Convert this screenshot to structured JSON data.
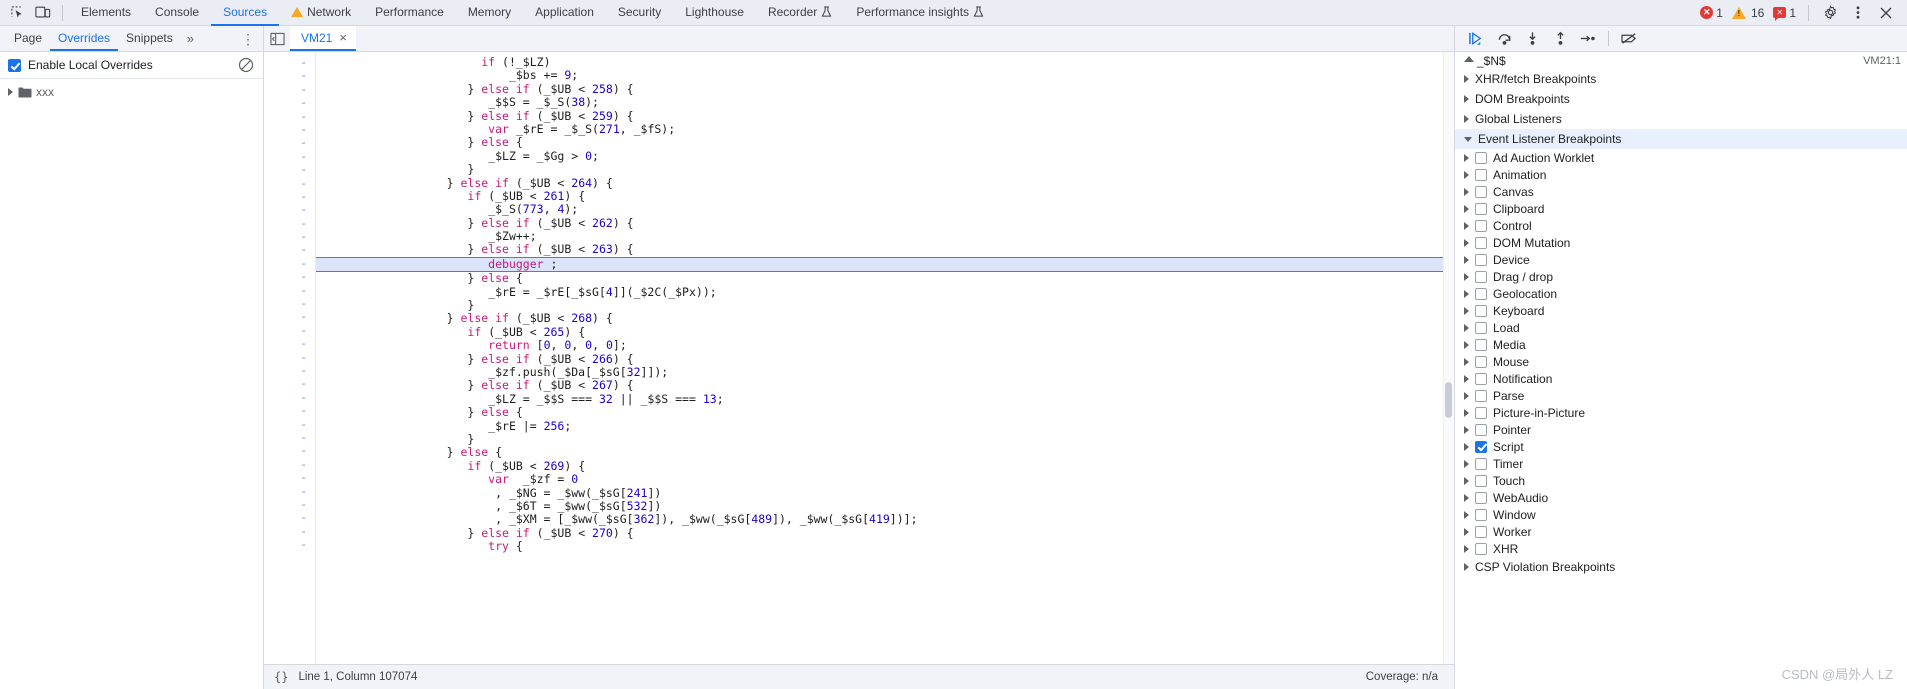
{
  "toolbar": {
    "inspect_icon": "inspect-element-icon",
    "device_icon": "device-toolbar-icon",
    "tabs": [
      {
        "label": "Elements",
        "active": false,
        "warn": false
      },
      {
        "label": "Console",
        "active": false,
        "warn": false
      },
      {
        "label": "Sources",
        "active": true,
        "warn": false
      },
      {
        "label": "Network",
        "active": false,
        "warn": true
      },
      {
        "label": "Performance",
        "active": false,
        "warn": false
      },
      {
        "label": "Memory",
        "active": false,
        "warn": false
      },
      {
        "label": "Application",
        "active": false,
        "warn": false
      },
      {
        "label": "Security",
        "active": false,
        "warn": false
      },
      {
        "label": "Lighthouse",
        "active": false,
        "warn": false
      },
      {
        "label": "Recorder",
        "active": false,
        "warn": false,
        "flask": true
      },
      {
        "label": "Performance insights",
        "active": false,
        "warn": false,
        "flask": true
      }
    ],
    "errors_count": "1",
    "warnings_count": "16",
    "messages_count": "1",
    "settings_icon": "gear-icon",
    "more_icon": "kebab-menu-icon",
    "close_icon": "close-icon"
  },
  "navigator": {
    "tabs": [
      {
        "label": "Page",
        "active": false
      },
      {
        "label": "Overrides",
        "active": true
      },
      {
        "label": "Snippets",
        "active": false
      }
    ],
    "more_label": "»",
    "kebab_label": "⋮",
    "overrides_checkbox_label": "Enable Local Overrides",
    "overrides_checked": true,
    "clear_icon": "clear-overrides-icon",
    "tree": [
      {
        "label": "xxx",
        "expanded": false,
        "icon": "folder-icon"
      }
    ]
  },
  "editor": {
    "panel_toggle_icon": "show-navigator-icon",
    "tab_name": "VM21",
    "tab_close": "×",
    "gutter_marker": "-",
    "line_count": 37,
    "status": {
      "format_icon": "{}",
      "position": "Line 1, Column 107074",
      "coverage": "Coverage: n/a"
    },
    "code_lines": [
      {
        "indent": 23,
        "tokens": [
          {
            "t": "if",
            "c": "kw"
          },
          {
            "t": " (!_$LZ)",
            "c": "var"
          }
        ]
      },
      {
        "indent": 27,
        "tokens": [
          {
            "t": "_$bs += ",
            "c": "var"
          },
          {
            "t": "9",
            "c": "num"
          },
          {
            "t": ";",
            "c": "var"
          }
        ]
      },
      {
        "indent": 21,
        "tokens": [
          {
            "t": "} ",
            "c": "var"
          },
          {
            "t": "else if",
            "c": "kw"
          },
          {
            "t": " (_$UB < ",
            "c": "var"
          },
          {
            "t": "258",
            "c": "num"
          },
          {
            "t": ") {",
            "c": "var"
          }
        ]
      },
      {
        "indent": 24,
        "tokens": [
          {
            "t": "_$$S = _$_S(",
            "c": "var"
          },
          {
            "t": "38",
            "c": "num"
          },
          {
            "t": ");",
            "c": "var"
          }
        ]
      },
      {
        "indent": 21,
        "tokens": [
          {
            "t": "} ",
            "c": "var"
          },
          {
            "t": "else if",
            "c": "kw"
          },
          {
            "t": " (_$UB < ",
            "c": "var"
          },
          {
            "t": "259",
            "c": "num"
          },
          {
            "t": ") {",
            "c": "var"
          }
        ]
      },
      {
        "indent": 24,
        "tokens": [
          {
            "t": "var",
            "c": "kw"
          },
          {
            "t": " _$rE = _$_S(",
            "c": "var"
          },
          {
            "t": "271",
            "c": "num"
          },
          {
            "t": ", _$fS);",
            "c": "var"
          }
        ]
      },
      {
        "indent": 21,
        "tokens": [
          {
            "t": "} ",
            "c": "var"
          },
          {
            "t": "else",
            "c": "kw"
          },
          {
            "t": " {",
            "c": "var"
          }
        ]
      },
      {
        "indent": 24,
        "tokens": [
          {
            "t": "_$LZ = _$Gg > ",
            "c": "var"
          },
          {
            "t": "0",
            "c": "num"
          },
          {
            "t": ";",
            "c": "var"
          }
        ]
      },
      {
        "indent": 21,
        "tokens": [
          {
            "t": "}",
            "c": "var"
          }
        ]
      },
      {
        "indent": 18,
        "tokens": [
          {
            "t": "} ",
            "c": "var"
          },
          {
            "t": "else if",
            "c": "kw"
          },
          {
            "t": " (_$UB < ",
            "c": "var"
          },
          {
            "t": "264",
            "c": "num"
          },
          {
            "t": ") {",
            "c": "var"
          }
        ]
      },
      {
        "indent": 21,
        "tokens": [
          {
            "t": "if",
            "c": "kw"
          },
          {
            "t": " (_$UB < ",
            "c": "var"
          },
          {
            "t": "261",
            "c": "num"
          },
          {
            "t": ") {",
            "c": "var"
          }
        ]
      },
      {
        "indent": 24,
        "tokens": [
          {
            "t": "_$_S(",
            "c": "var"
          },
          {
            "t": "773",
            "c": "num"
          },
          {
            "t": ", ",
            "c": "var"
          },
          {
            "t": "4",
            "c": "num"
          },
          {
            "t": ");",
            "c": "var"
          }
        ]
      },
      {
        "indent": 21,
        "tokens": [
          {
            "t": "} ",
            "c": "var"
          },
          {
            "t": "else if",
            "c": "kw"
          },
          {
            "t": " (_$UB < ",
            "c": "var"
          },
          {
            "t": "262",
            "c": "num"
          },
          {
            "t": ") {",
            "c": "var"
          }
        ]
      },
      {
        "indent": 24,
        "tokens": [
          {
            "t": "_$Zw++;",
            "c": "var"
          }
        ]
      },
      {
        "indent": 21,
        "tokens": [
          {
            "t": "} ",
            "c": "var"
          },
          {
            "t": "else if",
            "c": "kw"
          },
          {
            "t": " (_$UB < ",
            "c": "var"
          },
          {
            "t": "263",
            "c": "num"
          },
          {
            "t": ") {",
            "c": "var"
          }
        ]
      },
      {
        "indent": 24,
        "exec": true,
        "tokens": [
          {
            "t": "debugger",
            "c": "dbg"
          },
          {
            "t": " ;",
            "c": "var"
          }
        ]
      },
      {
        "indent": 21,
        "tokens": [
          {
            "t": "} ",
            "c": "var"
          },
          {
            "t": "else",
            "c": "kw"
          },
          {
            "t": " {",
            "c": "var"
          }
        ]
      },
      {
        "indent": 24,
        "tokens": [
          {
            "t": "_$rE = _$rE[_$sG[",
            "c": "var"
          },
          {
            "t": "4",
            "c": "num"
          },
          {
            "t": "]](_$2C(_$Px));",
            "c": "var"
          }
        ]
      },
      {
        "indent": 21,
        "tokens": [
          {
            "t": "}",
            "c": "var"
          }
        ]
      },
      {
        "indent": 18,
        "tokens": [
          {
            "t": "} ",
            "c": "var"
          },
          {
            "t": "else if",
            "c": "kw"
          },
          {
            "t": " (_$UB < ",
            "c": "var"
          },
          {
            "t": "268",
            "c": "num"
          },
          {
            "t": ") {",
            "c": "var"
          }
        ]
      },
      {
        "indent": 21,
        "tokens": [
          {
            "t": "if",
            "c": "kw"
          },
          {
            "t": " (_$UB < ",
            "c": "var"
          },
          {
            "t": "265",
            "c": "num"
          },
          {
            "t": ") {",
            "c": "var"
          }
        ]
      },
      {
        "indent": 24,
        "tokens": [
          {
            "t": "return",
            "c": "kw"
          },
          {
            "t": " [",
            "c": "var"
          },
          {
            "t": "0",
            "c": "num"
          },
          {
            "t": ", ",
            "c": "var"
          },
          {
            "t": "0",
            "c": "num"
          },
          {
            "t": ", ",
            "c": "var"
          },
          {
            "t": "0",
            "c": "num"
          },
          {
            "t": ", ",
            "c": "var"
          },
          {
            "t": "0",
            "c": "num"
          },
          {
            "t": "];",
            "c": "var"
          }
        ]
      },
      {
        "indent": 21,
        "tokens": [
          {
            "t": "} ",
            "c": "var"
          },
          {
            "t": "else if",
            "c": "kw"
          },
          {
            "t": " (_$UB < ",
            "c": "var"
          },
          {
            "t": "266",
            "c": "num"
          },
          {
            "t": ") {",
            "c": "var"
          }
        ]
      },
      {
        "indent": 24,
        "tokens": [
          {
            "t": "_$zf.push(_$Da[_$sG[",
            "c": "var"
          },
          {
            "t": "32",
            "c": "num"
          },
          {
            "t": "]]);",
            "c": "var"
          }
        ]
      },
      {
        "indent": 21,
        "tokens": [
          {
            "t": "} ",
            "c": "var"
          },
          {
            "t": "else if",
            "c": "kw"
          },
          {
            "t": " (_$UB < ",
            "c": "var"
          },
          {
            "t": "267",
            "c": "num"
          },
          {
            "t": ") {",
            "c": "var"
          }
        ]
      },
      {
        "indent": 24,
        "tokens": [
          {
            "t": "_$LZ = _$$S === ",
            "c": "var"
          },
          {
            "t": "32",
            "c": "num"
          },
          {
            "t": " || _$$S === ",
            "c": "var"
          },
          {
            "t": "13",
            "c": "num"
          },
          {
            "t": ";",
            "c": "var"
          }
        ]
      },
      {
        "indent": 21,
        "tokens": [
          {
            "t": "} ",
            "c": "var"
          },
          {
            "t": "else",
            "c": "kw"
          },
          {
            "t": " {",
            "c": "var"
          }
        ]
      },
      {
        "indent": 24,
        "tokens": [
          {
            "t": "_$rE |= ",
            "c": "var"
          },
          {
            "t": "256",
            "c": "num"
          },
          {
            "t": ";",
            "c": "var"
          }
        ]
      },
      {
        "indent": 21,
        "tokens": [
          {
            "t": "}",
            "c": "var"
          }
        ]
      },
      {
        "indent": 18,
        "tokens": [
          {
            "t": "} ",
            "c": "var"
          },
          {
            "t": "else",
            "c": "kw"
          },
          {
            "t": " {",
            "c": "var"
          }
        ]
      },
      {
        "indent": 21,
        "tokens": [
          {
            "t": "if",
            "c": "kw"
          },
          {
            "t": " (_$UB < ",
            "c": "var"
          },
          {
            "t": "269",
            "c": "num"
          },
          {
            "t": ") {",
            "c": "var"
          }
        ]
      },
      {
        "indent": 24,
        "tokens": [
          {
            "t": "var",
            "c": "kw"
          },
          {
            "t": "  _$zf = ",
            "c": "var"
          },
          {
            "t": "0",
            "c": "num"
          }
        ]
      },
      {
        "indent": 25,
        "tokens": [
          {
            "t": ", _$NG = _$ww(_$sG[",
            "c": "var"
          },
          {
            "t": "241",
            "c": "num"
          },
          {
            "t": "])",
            "c": "var"
          }
        ]
      },
      {
        "indent": 25,
        "tokens": [
          {
            "t": ", _$6T = _$ww(_$sG[",
            "c": "var"
          },
          {
            "t": "532",
            "c": "num"
          },
          {
            "t": "])",
            "c": "var"
          }
        ]
      },
      {
        "indent": 25,
        "tokens": [
          {
            "t": ", _$XM = [_$ww(_$sG[",
            "c": "var"
          },
          {
            "t": "362",
            "c": "num"
          },
          {
            "t": "]), _$ww(_$sG[",
            "c": "var"
          },
          {
            "t": "489",
            "c": "num"
          },
          {
            "t": "]), _$ww(_$sG[",
            "c": "var"
          },
          {
            "t": "419",
            "c": "num"
          },
          {
            "t": "])];",
            "c": "var"
          }
        ]
      },
      {
        "indent": 21,
        "tokens": [
          {
            "t": "} ",
            "c": "var"
          },
          {
            "t": "else if",
            "c": "kw"
          },
          {
            "t": " (_$UB < ",
            "c": "var"
          },
          {
            "t": "270",
            "c": "num"
          },
          {
            "t": ") {",
            "c": "var"
          }
        ]
      },
      {
        "indent": 24,
        "tokens": [
          {
            "t": "try",
            "c": "kw"
          },
          {
            "t": " {",
            "c": "var"
          }
        ]
      }
    ]
  },
  "debugger_panel": {
    "buttons": [
      {
        "name": "resume-script-execution",
        "icon": "resume-icon"
      },
      {
        "name": "step-over-next-function-call",
        "icon": "step-over-icon"
      },
      {
        "name": "step-into-next-function-call",
        "icon": "step-into-icon"
      },
      {
        "name": "step-out-of-current-function",
        "icon": "step-out-icon"
      },
      {
        "name": "step",
        "icon": "step-icon"
      },
      {
        "name": "deactivate-breakpoints",
        "icon": "deactivate-breakpoints-icon"
      }
    ],
    "scope_text": "_$N$",
    "source_ref": "VM21:1",
    "sections": [
      {
        "label": "XHR/fetch Breakpoints",
        "expanded": false,
        "active": false
      },
      {
        "label": "DOM Breakpoints",
        "expanded": false,
        "active": false
      },
      {
        "label": "Global Listeners",
        "expanded": false,
        "active": false
      },
      {
        "label": "Event Listener Breakpoints",
        "expanded": true,
        "active": true
      }
    ],
    "event_categories": [
      {
        "label": "Ad Auction Worklet",
        "checked": false
      },
      {
        "label": "Animation",
        "checked": false
      },
      {
        "label": "Canvas",
        "checked": false
      },
      {
        "label": "Clipboard",
        "checked": false
      },
      {
        "label": "Control",
        "checked": false
      },
      {
        "label": "DOM Mutation",
        "checked": false
      },
      {
        "label": "Device",
        "checked": false
      },
      {
        "label": "Drag / drop",
        "checked": false
      },
      {
        "label": "Geolocation",
        "checked": false
      },
      {
        "label": "Keyboard",
        "checked": false
      },
      {
        "label": "Load",
        "checked": false
      },
      {
        "label": "Media",
        "checked": false
      },
      {
        "label": "Mouse",
        "checked": false
      },
      {
        "label": "Notification",
        "checked": false
      },
      {
        "label": "Parse",
        "checked": false
      },
      {
        "label": "Picture-in-Picture",
        "checked": false
      },
      {
        "label": "Pointer",
        "checked": false
      },
      {
        "label": "Script",
        "checked": true
      },
      {
        "label": "Timer",
        "checked": false
      },
      {
        "label": "Touch",
        "checked": false
      },
      {
        "label": "WebAudio",
        "checked": false
      },
      {
        "label": "Window",
        "checked": false
      },
      {
        "label": "Worker",
        "checked": false
      },
      {
        "label": "XHR",
        "checked": false
      }
    ],
    "footer_section": {
      "label": "CSP Violation Breakpoints",
      "expanded": false
    }
  },
  "watermark": "CSDN @局外人 LZ",
  "colors": {
    "accent": "#1a73e8",
    "toolbar_bg": "#ebedf5",
    "panel_bg": "#f1f3f9",
    "exec_line_bg": "#dbe4f8",
    "error": "#e53935",
    "warning": "#f9a825"
  }
}
